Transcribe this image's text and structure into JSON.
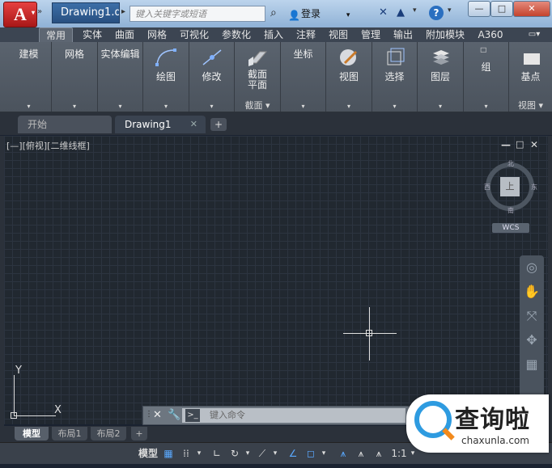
{
  "title_bar": {
    "app_button_label": "A",
    "doc_title": "Drawing1.d...",
    "search_placeholder": "键入关键字或短语",
    "login_label": "登录",
    "help_label": "?",
    "minimize_label": "—",
    "maximize_label": "□",
    "close_label": "✕"
  },
  "ribbon_tabs": [
    {
      "label": "常用",
      "active": true
    },
    {
      "label": "实体"
    },
    {
      "label": "曲面"
    },
    {
      "label": "网格"
    },
    {
      "label": "可视化"
    },
    {
      "label": "参数化"
    },
    {
      "label": "插入"
    },
    {
      "label": "注释"
    },
    {
      "label": "视图"
    },
    {
      "label": "管理"
    },
    {
      "label": "输出"
    },
    {
      "label": "附加模块"
    },
    {
      "label": "A360"
    }
  ],
  "ribbon_panels": {
    "modeling": "建模",
    "mesh": "网格",
    "solid_edit": "实体编辑",
    "draw": "绘图",
    "modify": "修改",
    "section_plane_1": "截面",
    "section_plane_2": "平面",
    "section_label": "截面 ▾",
    "coordinates": "坐标",
    "view": "视图",
    "selection": "选择",
    "layers": "图层",
    "groups": "组",
    "base_point": "基点",
    "view_label": "视图 ▾"
  },
  "file_tabs": {
    "start": "开始",
    "drawing": "Drawing1",
    "close": "✕",
    "add": "+"
  },
  "viewport": {
    "control": "[—][俯视][二维线框]",
    "win_min": "—",
    "win_restore": "□",
    "win_close": "✕",
    "viewcube_face": "上",
    "north": "北",
    "south": "南",
    "east": "东",
    "west": "西",
    "wcs": "WCS",
    "ucs_y": "Y",
    "ucs_x": "X"
  },
  "command_line": {
    "close": "✕",
    "settings": "🔧",
    "placeholder": "键入命令",
    "prompt": ">_"
  },
  "layout_tabs": [
    {
      "label": "模型",
      "active": true
    },
    {
      "label": "布局1"
    },
    {
      "label": "布局2"
    },
    {
      "label": "+"
    }
  ],
  "status_bar": {
    "model": "模型",
    "scale": "1:1"
  },
  "watermark": {
    "big": "查询啦",
    "small": "chaxunla.com"
  }
}
